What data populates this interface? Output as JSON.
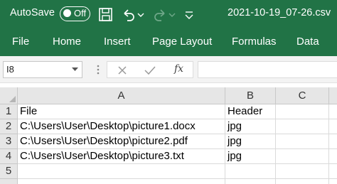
{
  "titlebar": {
    "autosave_label": "AutoSave",
    "autosave_state": "Off",
    "document_title": "2021-10-19_07-26.csv",
    "color": "#217346"
  },
  "ribbon": {
    "tabs": [
      "File",
      "Home",
      "Insert",
      "Page Layout",
      "Formulas",
      "Data"
    ]
  },
  "formula_bar": {
    "name_box": "I8",
    "fx_label": "fx",
    "formula": ""
  },
  "sheet": {
    "columns": [
      "A",
      "B",
      "C"
    ],
    "rows": [
      "1",
      "2",
      "3",
      "4",
      "5"
    ],
    "cells": [
      [
        "File",
        "Header",
        ""
      ],
      [
        "C:\\Users\\User\\Desktop\\picture1.docx",
        "jpg",
        ""
      ],
      [
        "C:\\Users\\User\\Desktop\\picture2.pdf",
        "jpg",
        ""
      ],
      [
        "C:\\Users\\User\\Desktop\\picture3.txt",
        "jpg",
        ""
      ],
      [
        "",
        "",
        ""
      ]
    ]
  },
  "icons": {
    "save": "save-icon",
    "undo": "undo-icon",
    "redo": "redo-icon",
    "cancel": "cancel-icon",
    "enter": "checkmark-icon"
  }
}
